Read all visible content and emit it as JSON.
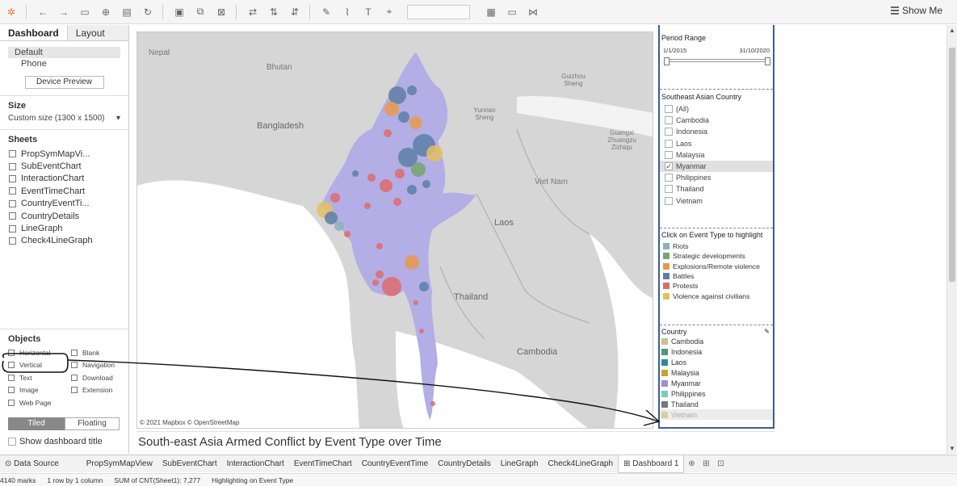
{
  "toolbar": {
    "show_me": "Show Me"
  },
  "left_pane": {
    "tabs": [
      "Dashboard",
      "Layout"
    ],
    "device_options": [
      "Default",
      "Phone"
    ],
    "device_preview_button": "Device Preview",
    "size_heading": "Size",
    "size_value": "Custom size (1300 x 1500)",
    "sheets_heading": "Sheets",
    "sheets": [
      "PropSymMapVi...",
      "SubEventChart",
      "InteractionChart",
      "EventTimeChart",
      "CountryEventTi...",
      "CountryDetails",
      "LineGraph",
      "Check4LineGraph"
    ],
    "objects_heading": "Objects",
    "objects": [
      "Horizontal",
      "Blank",
      "Vertical",
      "Navigation",
      "Text",
      "Download",
      "Image",
      "Extension",
      "Web Page"
    ],
    "tiled_label": "Tiled",
    "floating_label": "Floating",
    "show_title_label": "Show dashboard title"
  },
  "map": {
    "labels": [
      "Nepal",
      "Bhutan",
      "Bangladesh",
      "Yunnan Sheng",
      "Guizhou Sheng",
      "Guangxi Zhuangzu Zizhiqu",
      "Viet Nam",
      "Laos",
      "Thailand",
      "Cambodia"
    ],
    "attribution": "© 2021 Mapbox © OpenStreetMap",
    "region_color": "#b3aee6"
  },
  "dashboard_title": "South-east Asia Armed Conflict by Event Type over Time",
  "period_range": {
    "title": "Period Range",
    "start": "1/1/2015",
    "end": "31/10/2020"
  },
  "country_filter": {
    "title": "Southeast Asian Country",
    "items": [
      {
        "label": "(All)",
        "checked": false
      },
      {
        "label": "Cambodia",
        "checked": false
      },
      {
        "label": "Indonesia",
        "checked": false
      },
      {
        "label": "Laos",
        "checked": false
      },
      {
        "label": "Malaysia",
        "checked": false
      },
      {
        "label": "Myanmar",
        "checked": true
      },
      {
        "label": "Philippines",
        "checked": false
      },
      {
        "label": "Thailand",
        "checked": false
      },
      {
        "label": "Vietnam",
        "checked": false
      }
    ]
  },
  "event_types": {
    "title": "Click on Event Type to highlight",
    "items": [
      {
        "label": "Riots",
        "color": "#8fb0b8"
      },
      {
        "label": "Strategic developments",
        "color": "#74a66a"
      },
      {
        "label": "Explosions/Remote violence",
        "color": "#e8994a"
      },
      {
        "label": "Battles",
        "color": "#5b7fa6"
      },
      {
        "label": "Protests",
        "color": "#de6b6b"
      },
      {
        "label": "Violence against civilians",
        "color": "#e3c05f"
      }
    ]
  },
  "country_legend": {
    "title": "Country",
    "items": [
      {
        "label": "Cambodia",
        "color": "#c9c28a"
      },
      {
        "label": "Indonesia",
        "color": "#4a9a7e"
      },
      {
        "label": "Laos",
        "color": "#2b8ca0"
      },
      {
        "label": "Malaysia",
        "color": "#c8a52a"
      },
      {
        "label": "Myanmar",
        "color": "#9a8fd0"
      },
      {
        "label": "Philippines",
        "color": "#7fc9b8"
      },
      {
        "label": "Thailand",
        "color": "#777777"
      },
      {
        "label": "Vietnam",
        "color": "#d9cf9c"
      }
    ]
  },
  "tabs": [
    "Data Source",
    "PropSymMapView",
    "SubEventChart",
    "InteractionChart",
    "EventTimeChart",
    "CountryEventTime",
    "CountryDetails",
    "LineGraph",
    "Check4LineGraph",
    "Dashboard 1"
  ],
  "status": {
    "marks": "4140 marks",
    "rows": "1 row by 1 column",
    "sum": "SUM of CNT(Sheet1): 7,277",
    "highlight": "Highlighting on Event Type"
  }
}
